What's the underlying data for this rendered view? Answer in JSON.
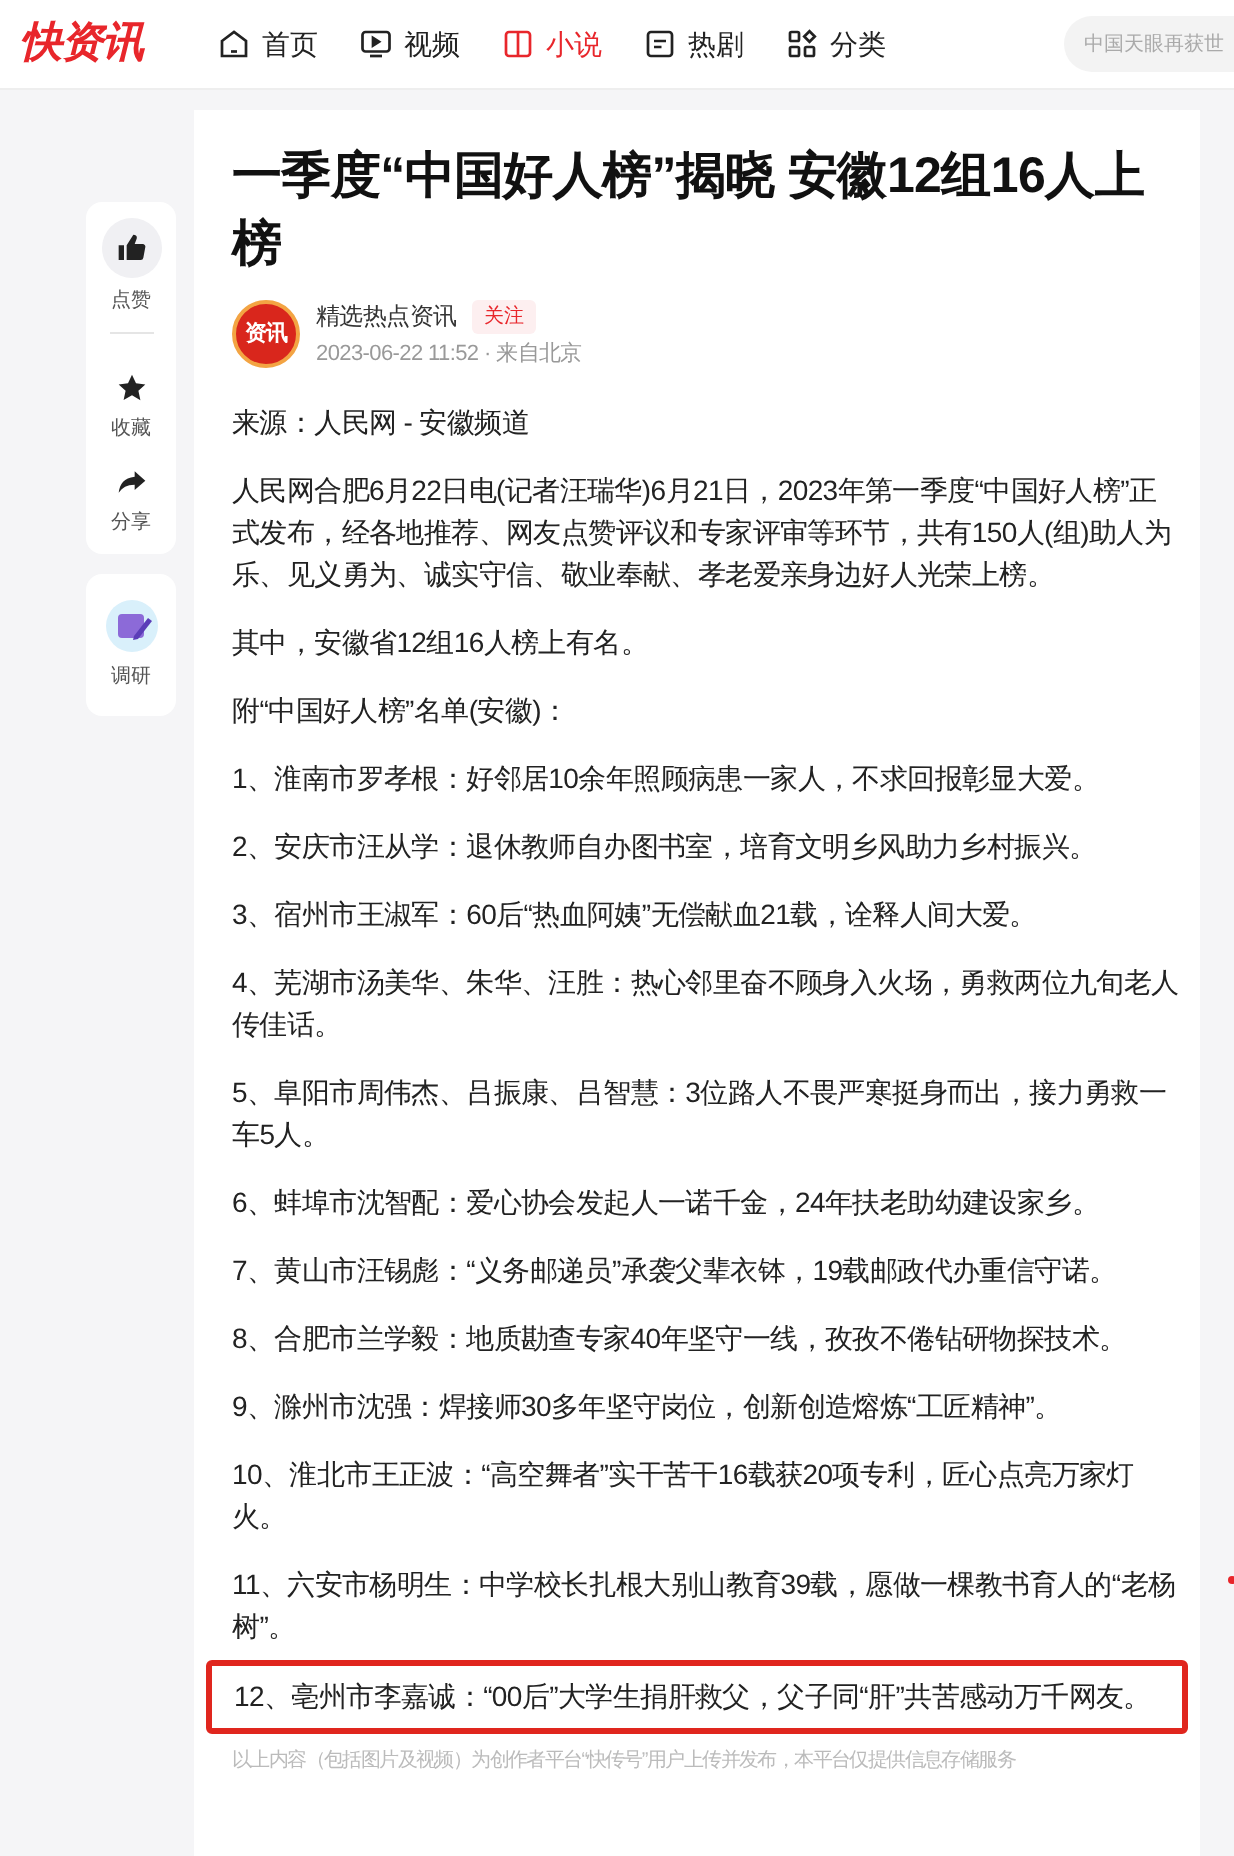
{
  "logo": "快资讯",
  "nav": [
    {
      "label": "首页",
      "kind": "home",
      "selected": false
    },
    {
      "label": "视频",
      "kind": "video",
      "selected": false
    },
    {
      "label": "小说",
      "kind": "book",
      "selected": true
    },
    {
      "label": "热剧",
      "kind": "list",
      "selected": false
    },
    {
      "label": "分类",
      "kind": "grid",
      "selected": false
    }
  ],
  "search": {
    "placeholder": "中国天眼再获世"
  },
  "side_actions": [
    {
      "label": "点赞",
      "kind": "thumb"
    },
    {
      "label": "收藏",
      "kind": "star"
    },
    {
      "label": "分享",
      "kind": "share"
    }
  ],
  "side_extra": {
    "label": "调研"
  },
  "article": {
    "title": "一季度“中国好人榜”揭晓 安徽12组16人上榜",
    "author": {
      "avatar_text": "资讯",
      "name": "精选热点资讯",
      "follow": "关注",
      "meta": "2023-06-22 11:52 · 来自北京"
    },
    "paragraphs": [
      {
        "text": "来源：人民网 - 安徽频道",
        "highlighted": false
      },
      {
        "text": "人民网合肥6月22日电(记者汪瑞华)6月21日，2023年第一季度“中国好人榜”正式发布，经各地推荐、网友点赞评议和专家评审等环节，共有150人(组)助人为乐、见义勇为、诚实守信、敬业奉献、孝老爱亲身边好人光荣上榜。",
        "highlighted": false
      },
      {
        "text": "其中，安徽省12组16人榜上有名。",
        "highlighted": false
      },
      {
        "text": "附“中国好人榜”名单(安徽)：",
        "highlighted": false
      },
      {
        "text": "1、淮南市罗孝根：好邻居10余年照顾病患一家人，不求回报彰显大爱。",
        "highlighted": false
      },
      {
        "text": "2、安庆市汪从学：退休教师自办图书室，培育文明乡风助力乡村振兴。",
        "highlighted": false
      },
      {
        "text": "3、宿州市王淑军：60后“热血阿姨”无偿献血21载，诠释人间大爱。",
        "highlighted": false
      },
      {
        "text": "4、芜湖市汤美华、朱华、汪胜：热心邻里奋不顾身入火场，勇救两位九旬老人传佳话。",
        "highlighted": false
      },
      {
        "text": "5、阜阳市周伟杰、吕振康、吕智慧：3位路人不畏严寒挺身而出，接力勇救一车5人。",
        "highlighted": false
      },
      {
        "text": "6、蚌埠市沈智配：爱心协会发起人一诺千金，24年扶老助幼建设家乡。",
        "highlighted": false
      },
      {
        "text": "7、黄山市汪锡彪：“义务邮递员”承袭父辈衣钵，19载邮政代办重信守诺。",
        "highlighted": false
      },
      {
        "text": "8、合肥市兰学毅：地质勘查专家40年坚守一线，孜孜不倦钻研物探技术。",
        "highlighted": false
      },
      {
        "text": "9、滁州市沈强：焊接师30多年坚守岗位，创新创造熔炼“工匠精神”。",
        "highlighted": false
      },
      {
        "text": "10、淮北市王正波：“高空舞者”实干苦干16载获20项专利，匠心点亮万家灯火。",
        "highlighted": false
      },
      {
        "text": "11、六安市杨明生：中学校长扎根大别山教育39载，愿做一棵教书育人的“老杨树”。",
        "highlighted": false
      },
      {
        "text": "12、亳州市李嘉诚：“00后”大学生捐肝救父，父子同“肝”共苦感动万千网友。",
        "highlighted": true
      }
    ],
    "disclaimer": "以上内容（包括图片及视频）为创作者平台“快传号”用户上传并发布，本平台仅提供信息存储服务"
  }
}
